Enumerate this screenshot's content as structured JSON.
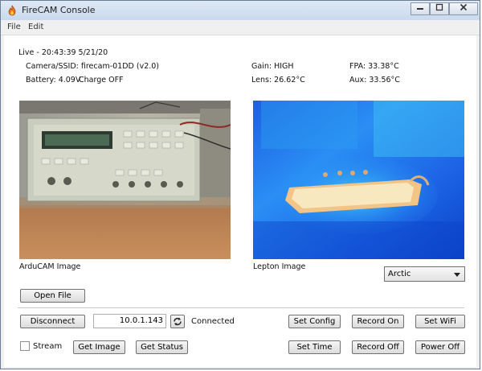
{
  "window": {
    "title": "FireCAM Console",
    "icon": "flame-icon",
    "controls": [
      "minimize-icon",
      "maximize-icon",
      "close-icon"
    ]
  },
  "menu": {
    "items": [
      "File",
      "Edit"
    ]
  },
  "status": {
    "live": "Live - 20:43:39 5/21/20",
    "camera_ssid": "Camera/SSID: firecam-01DD  (v2.0)",
    "battery": "Battery: 4.09V",
    "charge": "Charge OFF",
    "gain": "Gain: HIGH",
    "lens": "Lens: 26.62°C",
    "fpa": "FPA: 33.38°C",
    "aux": "Aux: 33.56°C"
  },
  "images": {
    "arducam_label": "ArduCAM Image",
    "lepton_label": "Lepton Image"
  },
  "palette": {
    "selected": "Arctic"
  },
  "buttons": {
    "open_file": "Open File",
    "disconnect": "Disconnect",
    "set_config": "Set Config",
    "record_on": "Record On",
    "set_wifi": "Set WiFi",
    "get_image": "Get Image",
    "get_status": "Get Status",
    "set_time": "Set Time",
    "record_off": "Record Off",
    "power_off": "Power Off"
  },
  "connection": {
    "ip_value": "10.0.1.143",
    "state": "Connected"
  },
  "stream": {
    "label": "Stream",
    "checked": false
  },
  "colors": {
    "thermal_bg": "#1a6fe0",
    "thermal_hot": "#f3e2b0"
  }
}
